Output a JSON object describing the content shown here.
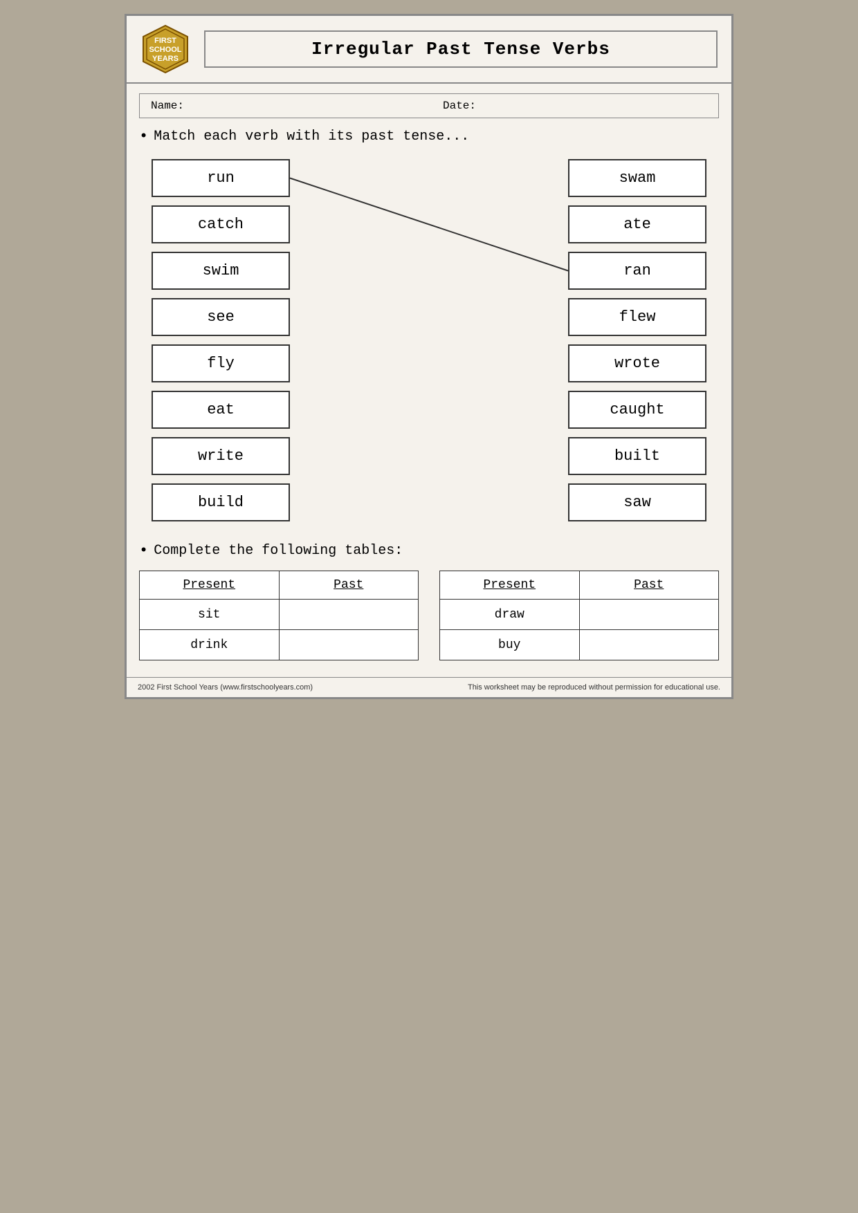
{
  "header": {
    "logo_line1": "FIRST",
    "logo_line2": "SCHOOL",
    "logo_line3": "YEARS",
    "title": "Irregular Past Tense Verbs"
  },
  "form": {
    "name_label": "Name:",
    "date_label": "Date:"
  },
  "instructions": {
    "match_text": "Match each verb with its past tense...",
    "complete_text": "Complete the following tables:"
  },
  "left_verbs": [
    {
      "word": "run"
    },
    {
      "word": "catch"
    },
    {
      "word": "swim"
    },
    {
      "word": "see"
    },
    {
      "word": "fly"
    },
    {
      "word": "eat"
    },
    {
      "word": "write"
    },
    {
      "word": "build"
    }
  ],
  "right_verbs": [
    {
      "word": "swam"
    },
    {
      "word": "ate"
    },
    {
      "word": "ran"
    },
    {
      "word": "flew"
    },
    {
      "word": "wrote"
    },
    {
      "word": "caught"
    },
    {
      "word": "built"
    },
    {
      "word": "saw"
    }
  ],
  "table1": {
    "col1_header": "Present",
    "col2_header": "Past",
    "rows": [
      {
        "present": "sit",
        "past": ""
      },
      {
        "present": "drink",
        "past": ""
      }
    ]
  },
  "table2": {
    "col1_header": "Present",
    "col2_header": "Past",
    "rows": [
      {
        "present": "draw",
        "past": ""
      },
      {
        "present": "buy",
        "past": ""
      }
    ]
  },
  "footer": {
    "left": "2002 First School Years  (www.firstschoolyears.com)",
    "right": "This worksheet may be reproduced without permission for educational use."
  }
}
